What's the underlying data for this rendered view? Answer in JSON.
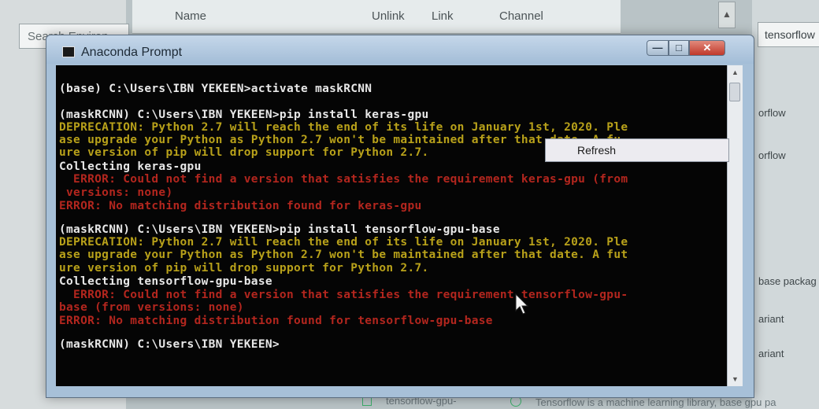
{
  "navigator": {
    "search_placeholder": "Search Environ",
    "columns": [
      "Name",
      "Unlink",
      "Link",
      "Channel"
    ],
    "search_value": "tensorflow",
    "right_items": [
      "orflow",
      "orflow",
      "base packag",
      "ariant",
      "ariant"
    ],
    "bottom_package": "tensorflow-gpu-",
    "bottom_description": "Tensorflow is a machine learning library, base gpu pa"
  },
  "window": {
    "title": "Anaconda Prompt",
    "buttons": {
      "minimize": "—",
      "maximize": "□",
      "close": "✕"
    }
  },
  "console": {
    "lines": [
      {
        "text": "(base) C:\\Users\\IBN YEKEEN>activate maskRCNN",
        "color": "w"
      },
      {
        "text": "(maskRCNN) C:\\Users\\IBN YEKEEN>pip install keras-gpu",
        "color": "w"
      },
      {
        "text": "DEPRECATION: Python 2.7 will reach the end of its life on January 1st, 2020. Ple",
        "color": "y"
      },
      {
        "text": "ase upgrade your Python as Python 2.7 won't be maintained after that date. A fu",
        "color": "y"
      },
      {
        "text": "ure version of pip will drop support for Python 2.7.",
        "color": "y"
      },
      {
        "text": "Collecting keras-gpu",
        "color": "w"
      },
      {
        "text": "  ERROR: Could not find a version that satisfies the requirement keras-gpu (from",
        "color": "r"
      },
      {
        "text": " versions: none)",
        "color": "r"
      },
      {
        "text": "ERROR: No matching distribution found for keras-gpu",
        "color": "r"
      },
      {
        "text": "(maskRCNN) C:\\Users\\IBN YEKEEN>pip install tensorflow-gpu-base",
        "color": "w"
      },
      {
        "text": "DEPRECATION: Python 2.7 will reach the end of its life on January 1st, 2020. Ple",
        "color": "y"
      },
      {
        "text": "ase upgrade your Python as Python 2.7 won't be maintained after that date. A fut",
        "color": "y"
      },
      {
        "text": "ure version of pip will drop support for Python 2.7.",
        "color": "y"
      },
      {
        "text": "Collecting tensorflow-gpu-base",
        "color": "w"
      },
      {
        "text": "  ERROR: Could not find a version that satisfies the requirement tensorflow-gpu-",
        "color": "r"
      },
      {
        "text": "base (from versions: none)",
        "color": "r"
      },
      {
        "text": "ERROR: No matching distribution found for tensorflow-gpu-base",
        "color": "r"
      },
      {
        "text": "(maskRCNN) C:\\Users\\IBN YEKEEN>",
        "color": "w"
      }
    ]
  },
  "context_menu": {
    "refresh": "Refresh"
  },
  "colors": {
    "console_bg": "#050505",
    "text": "#e8e8e8",
    "warning": "#b8a11a",
    "error": "#b3261e"
  }
}
